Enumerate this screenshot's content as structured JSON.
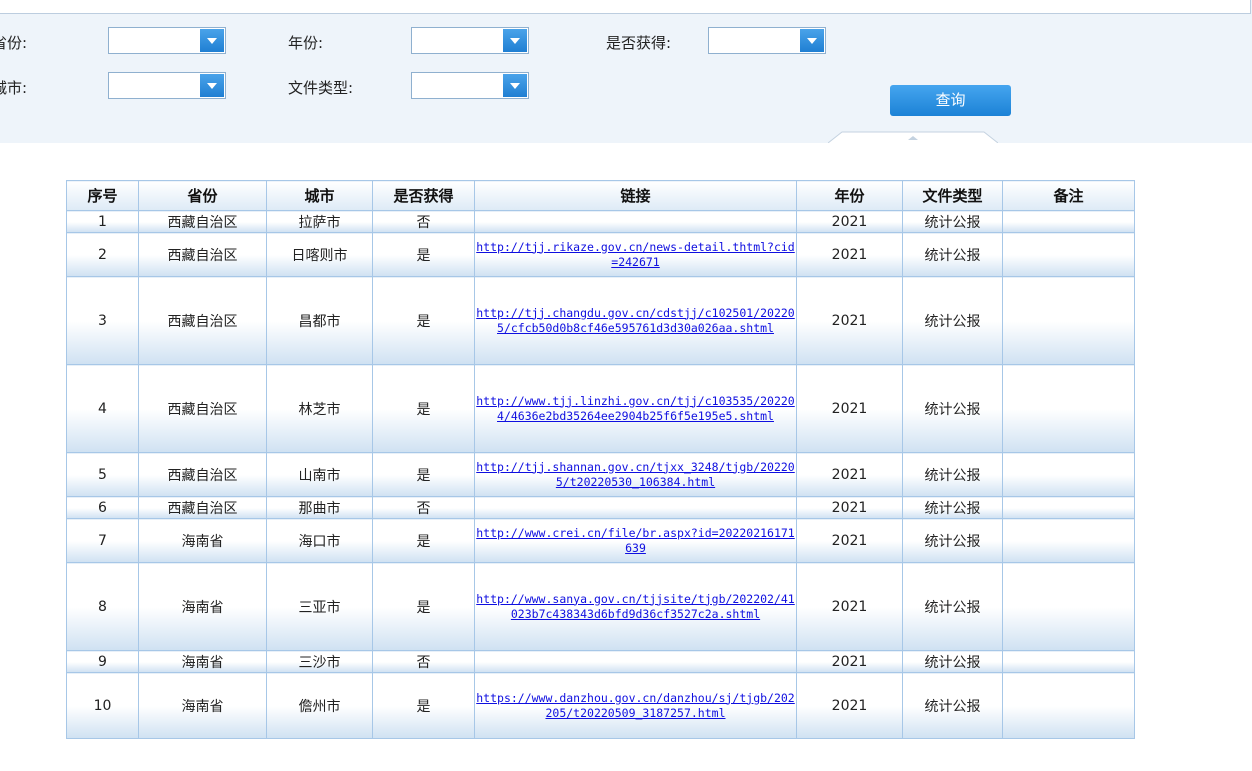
{
  "filters": {
    "province_label": "省份:",
    "city_label": "城市:",
    "year_label": "年份:",
    "filetype_label": "文件类型:",
    "obtained_label": "是否获得:",
    "province_value": "",
    "city_value": "",
    "year_value": "",
    "filetype_value": "",
    "obtained_value": "",
    "query_button": "查询"
  },
  "table": {
    "headers": [
      "序号",
      "省份",
      "城市",
      "是否获得",
      "链接",
      "年份",
      "文件类型",
      "备注"
    ],
    "rows": [
      {
        "no": "1",
        "province": "西藏自治区",
        "city": "拉萨市",
        "obtained": "否",
        "link": "",
        "year": "2021",
        "type": "统计公报",
        "note": ""
      },
      {
        "no": "2",
        "province": "西藏自治区",
        "city": "日喀则市",
        "obtained": "是",
        "link": "http://tjj.rikaze.gov.cn/news-detail.thtml?cid=242671",
        "year": "2021",
        "type": "统计公报",
        "note": ""
      },
      {
        "no": "3",
        "province": "西藏自治区",
        "city": "昌都市",
        "obtained": "是",
        "link": "http://tjj.changdu.gov.cn/cdstjj/c102501/202205/cfcb50d0b8cf46e595761d3d30a026aa.shtml",
        "year": "2021",
        "type": "统计公报",
        "note": ""
      },
      {
        "no": "4",
        "province": "西藏自治区",
        "city": "林芝市",
        "obtained": "是",
        "link": "http://www.tjj.linzhi.gov.cn/tjj/c103535/202204/4636e2bd35264ee2904b25f6f5e195e5.shtml",
        "year": "2021",
        "type": "统计公报",
        "note": ""
      },
      {
        "no": "5",
        "province": "西藏自治区",
        "city": "山南市",
        "obtained": "是",
        "link": "http://tjj.shannan.gov.cn/tjxx_3248/tjgb/202205/t20220530_106384.html",
        "year": "2021",
        "type": "统计公报",
        "note": ""
      },
      {
        "no": "6",
        "province": "西藏自治区",
        "city": "那曲市",
        "obtained": "否",
        "link": "",
        "year": "2021",
        "type": "统计公报",
        "note": ""
      },
      {
        "no": "7",
        "province": "海南省",
        "city": "海口市",
        "obtained": "是",
        "link": "http://www.crei.cn/file/br.aspx?id=20220216171639",
        "year": "2021",
        "type": "统计公报",
        "note": ""
      },
      {
        "no": "8",
        "province": "海南省",
        "city": "三亚市",
        "obtained": "是",
        "link": "http://www.sanya.gov.cn/tjjsite/tjgb/202202/41023b7c438343d6bfd9d36cf3527c2a.shtml",
        "year": "2021",
        "type": "统计公报",
        "note": ""
      },
      {
        "no": "9",
        "province": "海南省",
        "city": "三沙市",
        "obtained": "否",
        "link": "",
        "year": "2021",
        "type": "统计公报",
        "note": ""
      },
      {
        "no": "10",
        "province": "海南省",
        "city": "儋州市",
        "obtained": "是",
        "link": "https://www.danzhou.gov.cn/danzhou/sj/tjgb/202205/t20220509_3187257.html",
        "year": "2021",
        "type": "统计公报",
        "note": ""
      }
    ]
  }
}
